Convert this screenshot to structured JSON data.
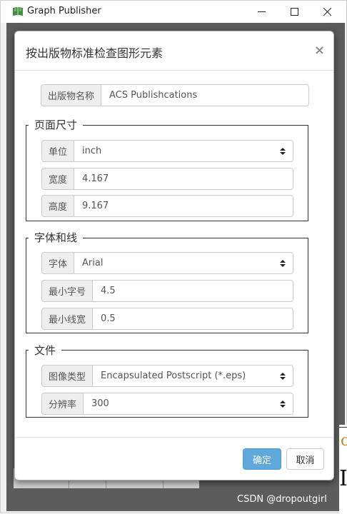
{
  "window": {
    "title": "Graph Publisher",
    "icon": "book-icon"
  },
  "dialog": {
    "title": "按出版物标准检查图形元素",
    "close_symbol": "×",
    "publication": {
      "label": "出版物名称",
      "value": "ACS Publishcations"
    },
    "page_size": {
      "legend": "页面尺寸",
      "unit": {
        "label": "单位",
        "value": "inch"
      },
      "width": {
        "label": "宽度",
        "value": "4.167"
      },
      "height": {
        "label": "高度",
        "value": "9.167"
      }
    },
    "font_line": {
      "legend": "字体和线",
      "font": {
        "label": "字体",
        "value": "Arial"
      },
      "min_font_size": {
        "label": "最小字号",
        "value": "4.5"
      },
      "min_line_width": {
        "label": "最小线宽",
        "value": "0.5"
      }
    },
    "file": {
      "legend": "文件",
      "image_type": {
        "label": "图像类型",
        "value": "Encapsulated Postscript (*.eps)"
      },
      "resolution": {
        "label": "分辨率",
        "value": "300"
      }
    },
    "buttons": {
      "ok": "确定",
      "cancel": "取消"
    }
  },
  "watermark": "CSDN @dropoutgirl",
  "colors": {
    "primary": "#5fa8dc",
    "backdrop": "#5c5c5c",
    "addon": "#eeeeee"
  }
}
